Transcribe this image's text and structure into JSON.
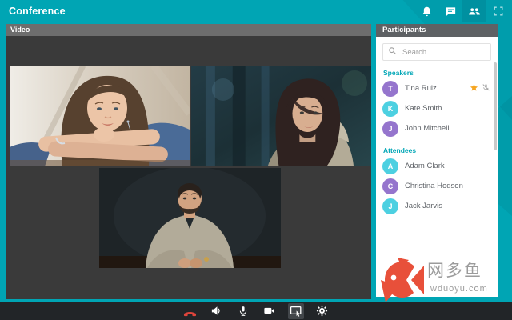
{
  "colors": {
    "teal_background": "#00a5b4",
    "active_topbar_button": "#0090a0",
    "sidebar_header_gray": "#5e6164",
    "section_label_teal": "#00a6b6",
    "avatar_purple": "#9575cd",
    "avatar_cyan": "#4dd0e1",
    "star_orange": "#f6a623",
    "hangup_red": "#e0453c",
    "watermark_red": "#e8503a"
  },
  "topbar": {
    "title": "Conference",
    "icons": [
      {
        "name": "notifications",
        "active": false
      },
      {
        "name": "chat",
        "active": false
      },
      {
        "name": "participants",
        "active": true
      },
      {
        "name": "fullscreen",
        "active": false
      }
    ]
  },
  "video_panel": {
    "title": "Video",
    "tiles": [
      {
        "id": "remote-video-1",
        "person": "woman-long-brown-hair-blue-sweater"
      },
      {
        "id": "remote-video-2",
        "person": "woman-dark-bob-beige-coat"
      },
      {
        "id": "remote-video-3",
        "person": "man-denim-shirt"
      }
    ]
  },
  "participants": {
    "title": "Participants",
    "search_placeholder": "Search",
    "sections": [
      {
        "label": "Speakers",
        "members": [
          {
            "initial": "T",
            "name": "Tina Ruiz",
            "avatar_color": "#9575cd",
            "starred": true,
            "muted": true
          },
          {
            "initial": "K",
            "name": "Kate Smith",
            "avatar_color": "#4dd0e1",
            "starred": false,
            "muted": false
          },
          {
            "initial": "J",
            "name": "John Mitchell",
            "avatar_color": "#9575cd",
            "starred": false,
            "muted": false
          }
        ]
      },
      {
        "label": "Attendees",
        "members": [
          {
            "initial": "A",
            "name": "Adam Clark",
            "avatar_color": "#4dd0e1",
            "starred": false,
            "muted": false
          },
          {
            "initial": "C",
            "name": "Christina Hodson",
            "avatar_color": "#9575cd",
            "starred": false,
            "muted": false
          },
          {
            "initial": "J",
            "name": "Jack Jarvis",
            "avatar_color": "#4dd0e1",
            "starred": false,
            "muted": false
          }
        ]
      }
    ]
  },
  "controls": {
    "buttons": [
      {
        "name": "hangup"
      },
      {
        "name": "volume"
      },
      {
        "name": "microphone"
      },
      {
        "name": "camera"
      },
      {
        "name": "screen-share",
        "active": true
      },
      {
        "name": "settings"
      }
    ]
  },
  "watermark": {
    "brand": "网多鱼",
    "domain": "wduoyu.com"
  }
}
